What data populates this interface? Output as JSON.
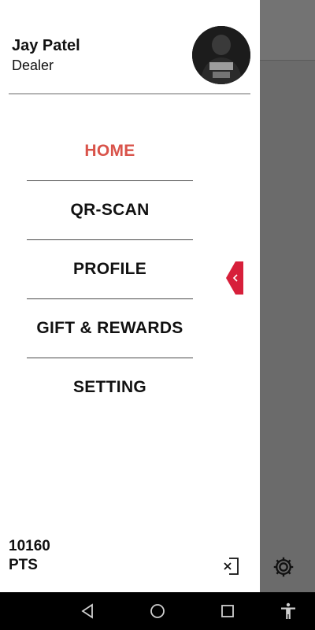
{
  "user": {
    "name": "Jay Patel",
    "role": "Dealer"
  },
  "menu": {
    "items": [
      {
        "label": "HOME",
        "active": true
      },
      {
        "label": "QR-SCAN",
        "active": false
      },
      {
        "label": "PROFILE",
        "active": false
      },
      {
        "label": "GIFT & REWARDS",
        "active": false
      },
      {
        "label": "SETTING",
        "active": false
      }
    ]
  },
  "points": {
    "value": "10160",
    "unit": "PTS"
  },
  "colors": {
    "accent": "#d9534a",
    "collapse_tab": "#d71f3a"
  },
  "icons": [
    "logout-icon",
    "settings-gear-icon",
    "collapse-arrow-icon",
    "back-icon",
    "home-icon",
    "recents-icon",
    "accessibility-icon"
  ]
}
